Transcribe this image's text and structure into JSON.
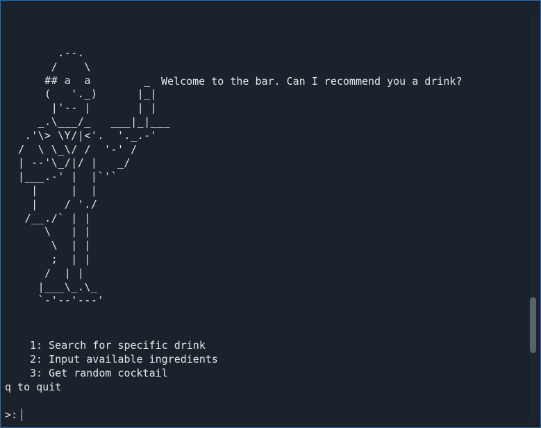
{
  "bartender_art": [
    "        .--.",
    "       /    \\",
    "      ## a  a        _",
    "      (   '._)      |_|",
    "       |'-- |       | |",
    "     _.\\___/_   ___|_|___",
    "   .'\\> \\Y/|<'.  '._.-'",
    "  /  \\ \\_\\/ /  '-' /",
    "  | --'\\_/|/ |   _/",
    "  |___.-' |  |`'`",
    "    |     |  |",
    "    |    / './",
    "   /__./` | |",
    "      \\   | |",
    "       \\  | |",
    "       ;  | |",
    "      /  | |",
    "     |___\\_.\\_",
    "     `-'--'---'"
  ],
  "welcome_message": "Welcome to the bar. Can I recommend you a drink?",
  "menu": {
    "options": [
      "1: Search for specific drink",
      "2: Input available ingredients",
      "3: Get random cocktail"
    ],
    "quit_hint": "q to quit"
  },
  "prompt": {
    "symbol": ">:",
    "input_value": ""
  }
}
